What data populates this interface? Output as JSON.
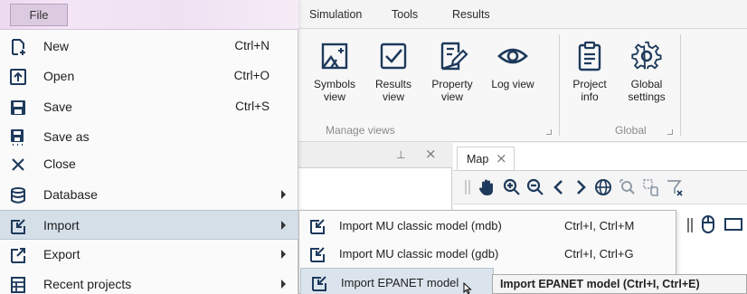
{
  "menubar": {
    "tabs": [
      "Simulation",
      "Tools",
      "Results"
    ]
  },
  "ribbon": {
    "manage_views": {
      "group_label": "Manage views",
      "buttons": [
        {
          "line1": "Symbols",
          "line2": "view",
          "icon": "symbols-view-icon"
        },
        {
          "line1": "Results",
          "line2": "view",
          "icon": "results-view-icon"
        },
        {
          "line1": "Property",
          "line2": "view",
          "icon": "property-view-icon"
        },
        {
          "line1": "Log view",
          "line2": "",
          "icon": "eye-icon"
        }
      ]
    },
    "global": {
      "group_label": "Global",
      "buttons": [
        {
          "line1": "Project",
          "line2": "info",
          "icon": "clipboard-icon"
        },
        {
          "line1": "Global",
          "line2": "settings",
          "icon": "gear-icon"
        }
      ]
    }
  },
  "panel": {
    "pin_glyph": "⊥",
    "close_glyph": "×"
  },
  "map": {
    "tab_label": "Map",
    "close_glyph": "×",
    "toolbar_icons": [
      "pan-hand-icon",
      "zoom-in-icon",
      "zoom-out-icon",
      "back-icon",
      "forward-icon",
      "globe-icon",
      "zoom-extent-icon",
      "zoom-select-icon",
      "filter-icon"
    ]
  },
  "file_menu": {
    "tab_label": "File",
    "items": [
      {
        "label": "New",
        "shortcut": "Ctrl+N",
        "icon": "new-file-icon",
        "submenu": false
      },
      {
        "label": "Open",
        "shortcut": "Ctrl+O",
        "icon": "open-icon",
        "submenu": false
      },
      {
        "label": "Save",
        "shortcut": "Ctrl+S",
        "icon": "save-icon",
        "submenu": false
      },
      {
        "label": "Save as",
        "shortcut": "",
        "icon": "save-as-icon",
        "submenu": false
      },
      {
        "label": "Close",
        "shortcut": "",
        "icon": "close-icon",
        "submenu": false
      },
      {
        "label": "Database",
        "shortcut": "",
        "icon": "database-icon",
        "submenu": true
      },
      {
        "label": "Import",
        "shortcut": "",
        "icon": "import-icon",
        "submenu": true,
        "highlighted": true
      },
      {
        "label": "Export",
        "shortcut": "",
        "icon": "export-icon",
        "submenu": true
      },
      {
        "label": "Recent projects",
        "shortcut": "",
        "icon": "recent-projects-icon",
        "submenu": true
      }
    ]
  },
  "import_submenu": {
    "items": [
      {
        "label": "Import MU classic model (mdb)",
        "shortcut": "Ctrl+I, Ctrl+M"
      },
      {
        "label": "Import MU classic model (gdb)",
        "shortcut": "Ctrl+I, Ctrl+G"
      },
      {
        "label": "Import EPANET model",
        "shortcut": "",
        "highlighted": true
      }
    ]
  },
  "tooltip": {
    "text": "Import EPANET model (Ctrl+I, Ctrl+E)"
  },
  "colors": {
    "highlight": "#d5dfe8",
    "file_tab": "#dccbe0",
    "icon_dark": "#1e3a5c"
  }
}
